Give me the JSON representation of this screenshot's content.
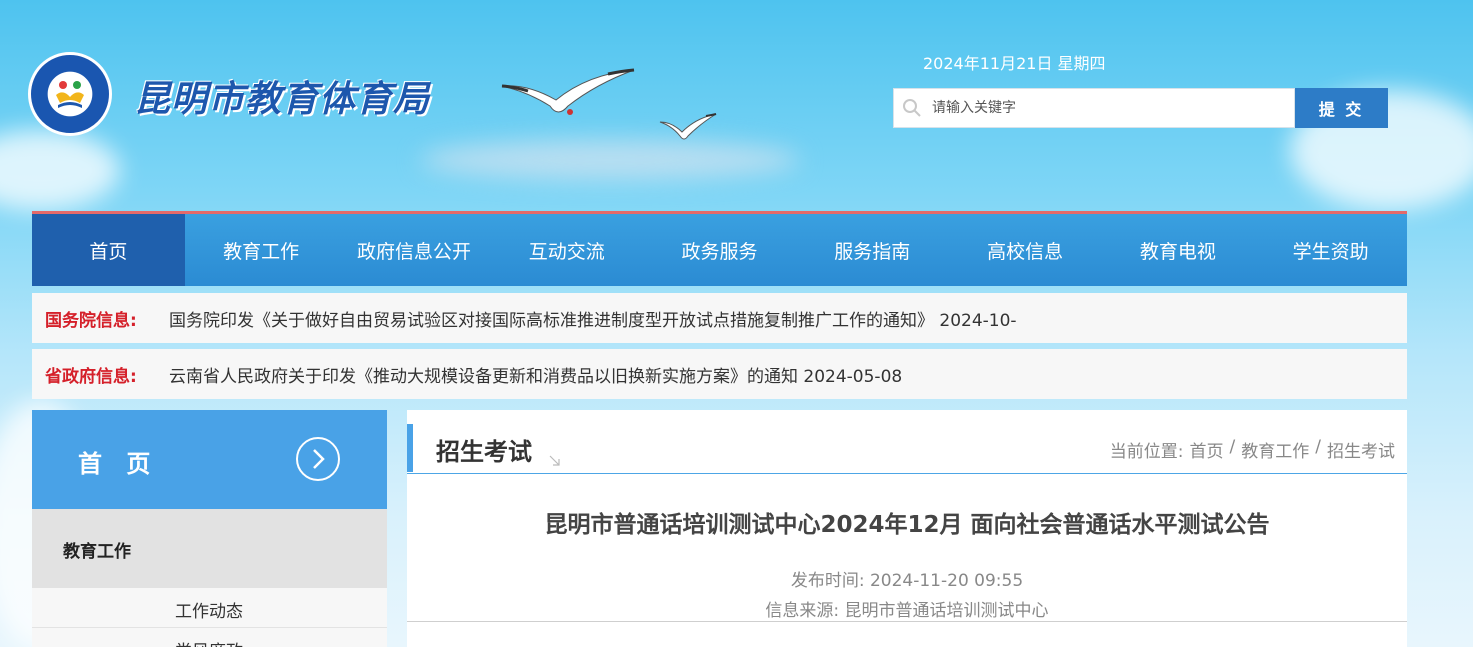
{
  "header": {
    "site_title": "昆明市教育体育局",
    "date": "2024年11月21日 星期四",
    "search": {
      "placeholder": "请输入关键字",
      "submit_label": "提 交"
    }
  },
  "nav": {
    "items": [
      "首页",
      "教育工作",
      "政府信息公开",
      "互动交流",
      "政务服务",
      "服务指南",
      "高校信息",
      "教育电视",
      "学生资助"
    ],
    "active_index": 0
  },
  "notices": [
    {
      "label": "国务院信息:",
      "text": "国务院印发《关于做好自由贸易试验区对接国际高标准推进制度型开放试点措施复制推广工作的通知》 2024-10-"
    },
    {
      "label": "省政府信息:",
      "text": "云南省人民政府关于印发《推动大规模设备更新和消费品以旧换新实施方案》的通知 2024-05-08"
    }
  ],
  "sidebar": {
    "head_title": "首 页",
    "category": "教育工作",
    "items": [
      "工作动态",
      "党风廉政"
    ]
  },
  "main": {
    "section_title": "招生考试",
    "breadcrumb": {
      "prefix": "当前位置:",
      "items": [
        "首页",
        "/",
        "教育工作",
        "/",
        "招生考试"
      ]
    },
    "article": {
      "title": "昆明市普通话培训测试中心2024年12月 面向社会普通话水平测试公告",
      "publish_time": "发布时间: 2024-11-20 09:55",
      "source": "信息来源: 昆明市普通话培训测试中心"
    }
  },
  "colors": {
    "accent_blue": "#2d7cc7",
    "nav_active": "#1f60ad",
    "notice_label_red": "#d5202a"
  }
}
